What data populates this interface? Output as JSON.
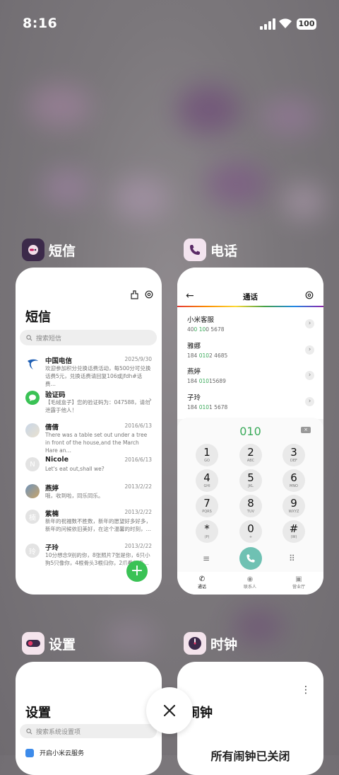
{
  "status_bar": {
    "time": "8:16",
    "battery": "100"
  },
  "apps": {
    "sms": {
      "name": "短信",
      "title": "短信",
      "search_placeholder": "搜索短信",
      "messages": [
        {
          "name": "中国电信",
          "date": "2025/9/30",
          "preview": "欢迎参加积分兑换话费活动，每500分可兑换话费5元，兑换话费请回复106或jfdh#话费…",
          "avatar": "telecom"
        },
        {
          "name": "验证码",
          "date": "",
          "preview": "【毛绒盒子】您的验证码为：047588，请勿泄露于他人！",
          "avatar": "code"
        },
        {
          "name": "倩倩",
          "date": "2016/6/13",
          "preview": "There was a table set out under a tree in front of the house,and the March Hare an…",
          "avatar": "photo1"
        },
        {
          "name": "Nicole",
          "date": "2016/6/13",
          "preview": "Let's eat out,shall we?",
          "avatar": "N"
        },
        {
          "name": "燕婷",
          "date": "2013/2/22",
          "preview": "哦，收到啦，同乐同乐。",
          "avatar": "photo2"
        },
        {
          "name": "紫楠",
          "date": "2013/2/22",
          "preview": "新年的祝福数不胜数，新年的愿望好多好多，新年的问候依旧美好，在这个温馨的时刻，…",
          "avatar": "楠"
        },
        {
          "name": "子玲",
          "date": "2013/2/22",
          "preview": "10分想念9别的你，8张照片7张是你，6只小狗5只像你，4根骨头3根归你，2爪看如来…",
          "avatar": "玲"
        }
      ],
      "fab_label": "+"
    },
    "phone": {
      "name": "电话",
      "title": "通话",
      "back_glyph": "←",
      "contacts": [
        {
          "name": "小米客服",
          "num_pre": "40",
          "num_hl": "0 10",
          "num_post": "0 5678"
        },
        {
          "name": "雅娜",
          "num_pre": "184 ",
          "num_hl": "010",
          "num_post": "2 4685"
        },
        {
          "name": "燕婷",
          "num_pre": "184 ",
          "num_hl": "010",
          "num_post": "15689"
        },
        {
          "name": "子玲",
          "num_pre": "184 ",
          "num_hl": "010",
          "num_post": "1 5678"
        }
      ],
      "dialed": "010",
      "keys": [
        {
          "d": "1",
          "l": "GO"
        },
        {
          "d": "2",
          "l": "ABC"
        },
        {
          "d": "3",
          "l": "DEF"
        },
        {
          "d": "4",
          "l": "GHI"
        },
        {
          "d": "5",
          "l": "JKL"
        },
        {
          "d": "6",
          "l": "MNO"
        },
        {
          "d": "7",
          "l": "PQRS"
        },
        {
          "d": "8",
          "l": "TUV"
        },
        {
          "d": "9",
          "l": "WXYZ"
        },
        {
          "d": "*",
          "l": "(P)"
        },
        {
          "d": "0",
          "l": "+"
        },
        {
          "d": "#",
          "l": "(W)"
        }
      ],
      "tabs": [
        "通话",
        "联系人",
        "营业厅"
      ]
    },
    "settings": {
      "name": "设置",
      "title": "设置",
      "search_placeholder": "搜索系统设置项",
      "first_item": "开启小米云服务"
    },
    "clock": {
      "name": "时钟",
      "title": "闹钟",
      "message": "所有闹钟已关闭"
    }
  },
  "colors": {
    "sms_icon": "#3c2a4a",
    "phone_icon": "#f3e4ef",
    "accent_green": "#3ac255",
    "dial_green": "#3aaa5a"
  }
}
